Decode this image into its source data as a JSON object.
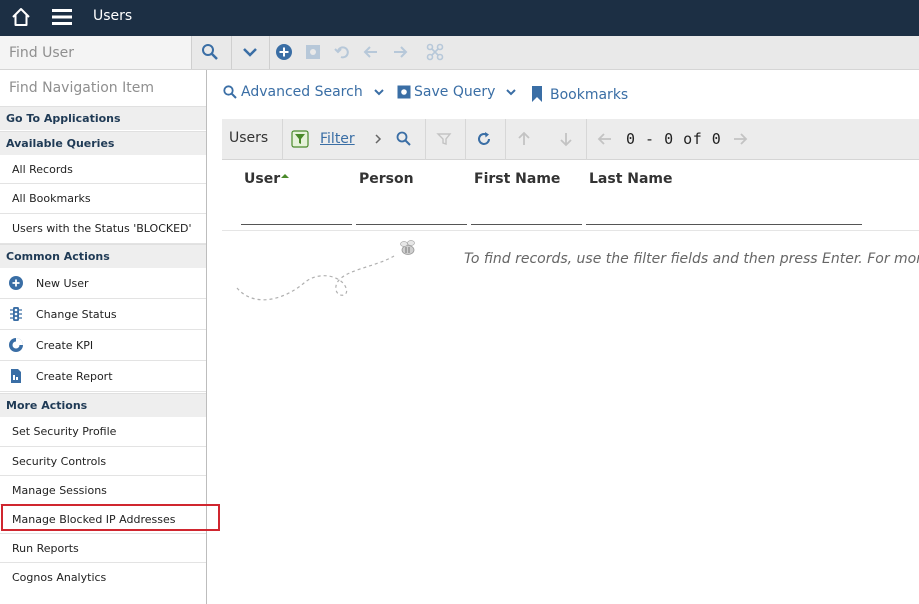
{
  "header": {
    "title": "Users"
  },
  "toolbar": {
    "find_placeholder": "Find User"
  },
  "sidebar": {
    "find_placeholder": "Find Navigation Item",
    "sections": {
      "go_to": "Go To Applications",
      "available_queries": "Available Queries",
      "common_actions": "Common Actions",
      "more_actions": "More Actions"
    },
    "queries": [
      "All Records",
      "All Bookmarks",
      "Users with the Status 'BLOCKED'"
    ],
    "common": [
      "New User",
      "Change Status",
      "Create KPI",
      "Create Report"
    ],
    "more": [
      "Set Security Profile",
      "Security Controls",
      "Manage Sessions",
      "Manage Blocked IP Addresses",
      "Run Reports",
      "Cognos Analytics"
    ]
  },
  "actions": {
    "advanced_search": "Advanced Search",
    "save_query": "Save Query",
    "bookmarks": "Bookmarks"
  },
  "list": {
    "title": "Users",
    "filter": "Filter",
    "count": "0 - 0 of 0",
    "columns": [
      "User",
      "Person",
      "First Name",
      "Last Name"
    ],
    "empty_message": "To find records, use the filter fields and then press Enter. For more se"
  },
  "colors": {
    "topbar": "#1c2f44",
    "accent": "#3a6ea5",
    "highlight": "#d0262f"
  }
}
